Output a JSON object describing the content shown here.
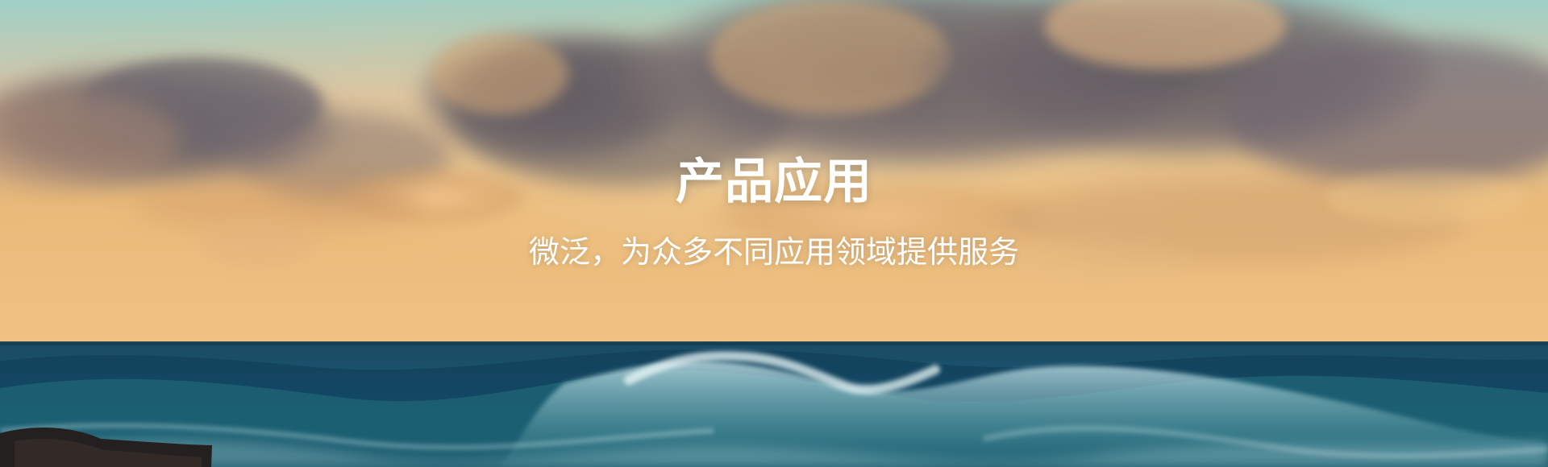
{
  "banner": {
    "title": "产品应用",
    "subtitle": "微泛，为众多不同应用领域提供服务"
  },
  "colors": {
    "sky_top": "#9fcfc4",
    "sky_horizon": "#e9bd82",
    "cloud_dark": "#6f666b",
    "cloud_light": "#d7a46c",
    "sea_deep": "#0f3e58",
    "sea_mid": "#1d6173",
    "foam": "#d8eef0",
    "text": "#ffffff"
  },
  "icons": {
    "background": "ocean-sunset-image"
  }
}
